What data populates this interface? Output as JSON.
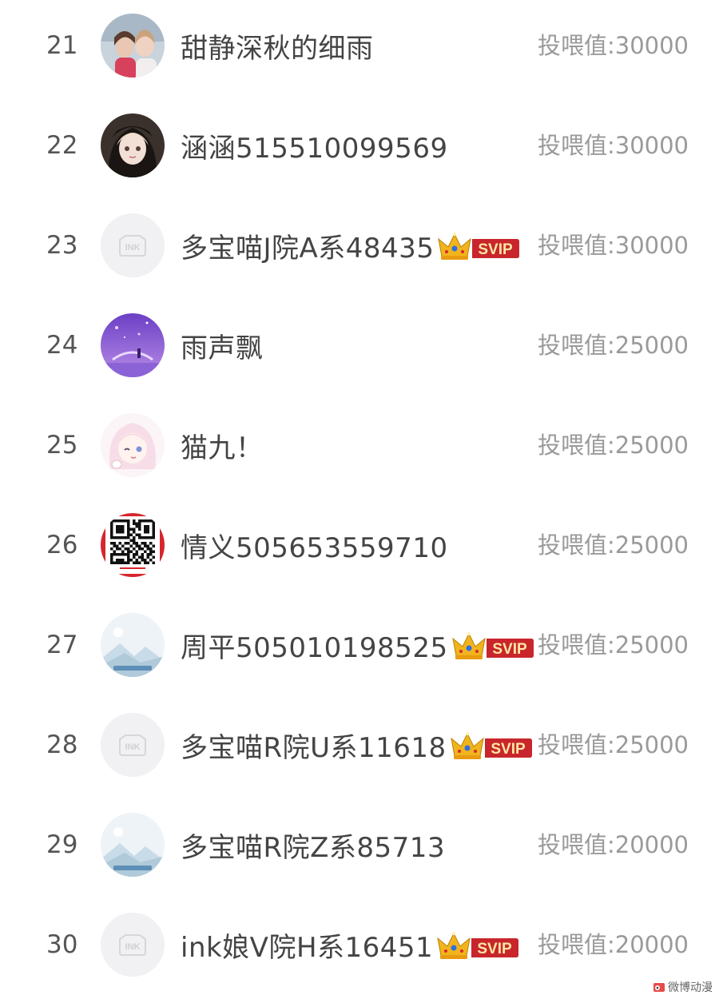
{
  "rows": [
    {
      "rank": "21",
      "name": "甜静深秋的细雨",
      "value": "投喂值:30000",
      "avatar": "photo-avatar",
      "svip": false
    },
    {
      "rank": "22",
      "name": "涵涵515510099569",
      "value": "投喂值:30000",
      "avatar": "doll-avatar",
      "svip": false
    },
    {
      "rank": "23",
      "name": "多宝喵J院A系48435",
      "value": "投喂值:30000",
      "avatar": "ink-default-avatar",
      "svip": true
    },
    {
      "rank": "24",
      "name": "雨声飘",
      "value": "投喂值:25000",
      "avatar": "purple-scene-avatar",
      "svip": false
    },
    {
      "rank": "25",
      "name": "猫九！",
      "value": "投喂值:25000",
      "avatar": "anime-girl-avatar",
      "svip": false
    },
    {
      "rank": "26",
      "name": "情义505653559710",
      "value": "投喂值:25000",
      "avatar": "qr-code-avatar",
      "svip": false
    },
    {
      "rank": "27",
      "name": "周平505010198525",
      "value": "投喂值:25000",
      "avatar": "landscape-avatar",
      "svip": true
    },
    {
      "rank": "28",
      "name": "多宝喵R院U系11618",
      "value": "投喂值:25000",
      "avatar": "ink-default-avatar",
      "svip": true
    },
    {
      "rank": "29",
      "name": "多宝喵R院Z系85713",
      "value": "投喂值:20000",
      "avatar": "landscape-avatar",
      "svip": false
    },
    {
      "rank": "30",
      "name": "ink娘V院H系16451",
      "value": "投喂值:20000",
      "avatar": "ink-default-avatar",
      "svip": true
    }
  ],
  "svip_label": "SVIP",
  "ink_label": "INK",
  "watermark": "微博动漫",
  "colors": {
    "rank": "#555555",
    "name": "#444444",
    "value": "#9a9a9a",
    "svip_red": "#c8262c",
    "crown_gold": "#f2b41c"
  }
}
